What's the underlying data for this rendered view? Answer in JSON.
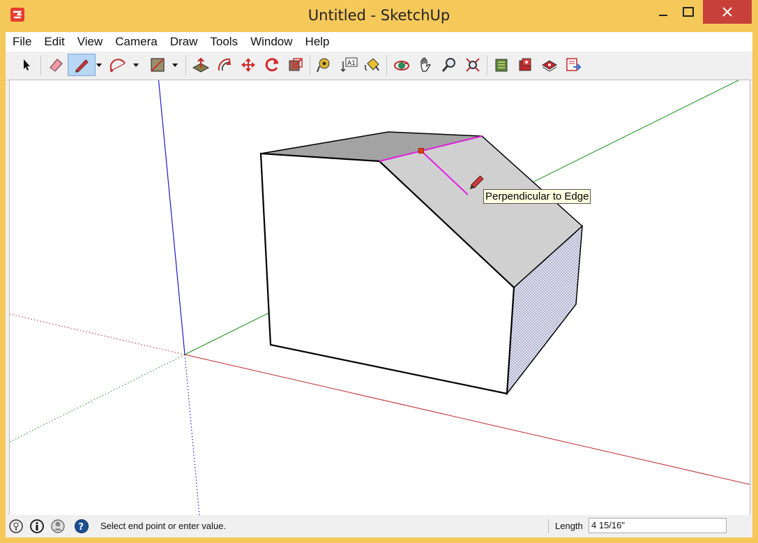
{
  "window": {
    "title": "Untitled - SketchUp",
    "icons": {
      "app": "sketchup-logo-icon",
      "minimize": "minimize-icon",
      "maximize": "maximize-icon",
      "close": "close-icon"
    }
  },
  "menu": {
    "items": [
      "File",
      "Edit",
      "View",
      "Camera",
      "Draw",
      "Tools",
      "Window",
      "Help"
    ]
  },
  "toolbar": {
    "tools": [
      {
        "name": "select",
        "icon": "select-arrow-icon"
      },
      {
        "name": "eraser",
        "icon": "eraser-icon"
      },
      {
        "name": "line",
        "icon": "pencil-line-icon",
        "active": true
      },
      {
        "name": "arc",
        "icon": "arc-icon"
      },
      {
        "name": "rectangle",
        "icon": "rectangle-icon"
      },
      {
        "name": "push-pull",
        "icon": "push-pull-icon"
      },
      {
        "name": "offset",
        "icon": "offset-icon"
      },
      {
        "name": "move",
        "icon": "move-icon"
      },
      {
        "name": "rotate",
        "icon": "rotate-icon"
      },
      {
        "name": "scale",
        "icon": "scale-icon"
      },
      {
        "name": "tape-measure",
        "icon": "tape-measure-icon"
      },
      {
        "name": "text",
        "icon": "text-icon",
        "label": "A1"
      },
      {
        "name": "paint-bucket",
        "icon": "paint-bucket-icon"
      },
      {
        "name": "orbit",
        "icon": "orbit-icon"
      },
      {
        "name": "pan",
        "icon": "pan-hand-icon"
      },
      {
        "name": "zoom",
        "icon": "zoom-icon"
      },
      {
        "name": "zoom-extents",
        "icon": "zoom-extents-icon"
      },
      {
        "name": "3d-warehouse",
        "icon": "warehouse-icon"
      },
      {
        "name": "extension-warehouse",
        "icon": "extension-warehouse-icon"
      },
      {
        "name": "share-model",
        "icon": "share-model-icon"
      },
      {
        "name": "layout",
        "icon": "send-to-layout-icon"
      }
    ]
  },
  "viewport": {
    "tooltip": "Perpendicular to Edge",
    "cursor": "pencil-cursor-icon"
  },
  "statusbar": {
    "icons": [
      "geo-location-icon",
      "credits-info-icon",
      "user-account-icon",
      "help-icon"
    ],
    "message": "Select end point or enter value.",
    "length_label": "Length",
    "length_value": "4 15/16\""
  },
  "colors": {
    "title_bar": "#f5c85a",
    "close_button": "#c7403a",
    "axis_red": "#c0282c",
    "axis_green": "#1a8f1a",
    "axis_blue": "#1a1acb",
    "inference_magenta": "#e020e0",
    "tooltip_bg": "#ffffe1"
  }
}
